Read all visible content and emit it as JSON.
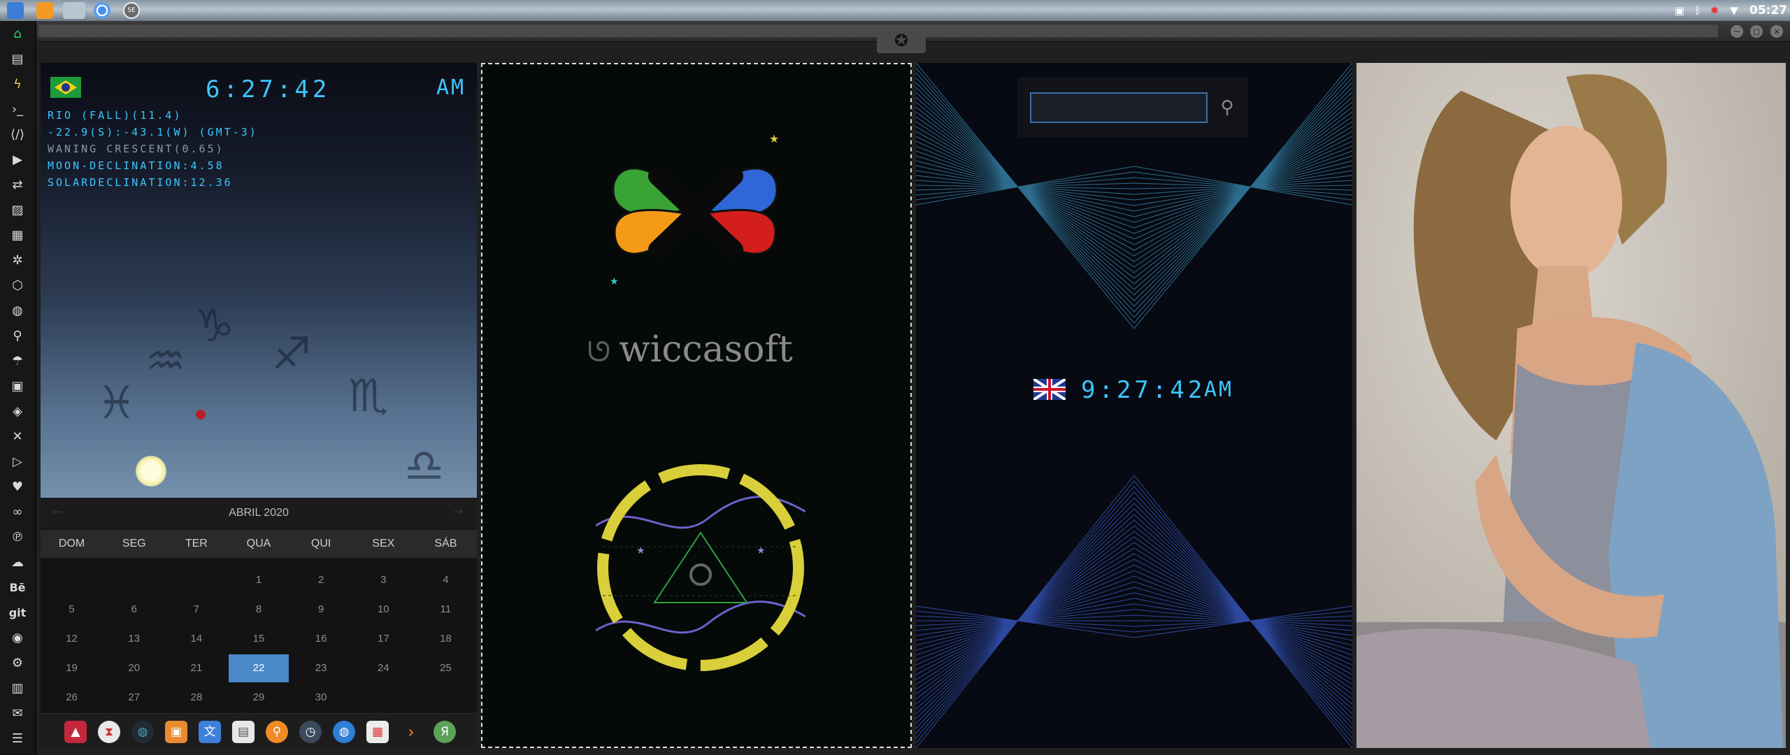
{
  "topbar": {
    "apps": [
      "files-icon",
      "sublime-icon",
      "blank-window",
      "chrome-icon",
      "se-icon"
    ],
    "se_label": "SE",
    "clock": "05:27"
  },
  "left_dock": {
    "items": [
      "home-icon",
      "document-icon",
      "flash-icon",
      "terminal-icon",
      "code-icon",
      "video-icon",
      "file-transfer-icon",
      "image-icon",
      "news-icon",
      "settings-icon",
      "hexagon-icon",
      "globe-icon",
      "search-icon",
      "umbrella-icon",
      "contacts-icon",
      "git-diff-icon",
      "shuffle-icon",
      "youtube-icon",
      "heart-icon",
      "link-icon",
      "pinterest-icon",
      "cloud-icon",
      "behance-icon",
      "git-icon",
      "github-icon",
      "bike-icon",
      "map-icon",
      "mail-icon",
      "terminal-window-icon"
    ],
    "behance_label": "Bē",
    "git_label": "git"
  },
  "window": {
    "rebel_glyph": "✪"
  },
  "brazil_clock": {
    "time": "6:27:42",
    "ampm": "AM",
    "location": "RIO (FALL)(11.4)",
    "coords": "-22.9(S):-43.1(W) (GMT-3)",
    "moon_phase": "WANING CRESCENT(0.65)",
    "moon_declination": "MOON-DECLINATION:4.58",
    "solar_declination": "SOLARDECLINATION:12.36"
  },
  "calendar": {
    "month": "ABRIL 2020",
    "weekdays": [
      "DOM",
      "SEG",
      "TER",
      "QUA",
      "QUI",
      "SEX",
      "SÁB"
    ],
    "days": [
      "1",
      "2",
      "3",
      "4",
      "5",
      "6",
      "7",
      "8",
      "9",
      "10",
      "11",
      "12",
      "13",
      "14",
      "15",
      "16",
      "17",
      "18",
      "19",
      "20",
      "21",
      "22",
      "23",
      "24",
      "25",
      "26",
      "27",
      "28",
      "29",
      "30"
    ],
    "first_weekday_index": 3,
    "today": "22",
    "prev_glyph": "←",
    "next_glyph": "→"
  },
  "app_dock": {
    "items": [
      "arch-icon",
      "hourglass-icon",
      "globe-dark-icon",
      "photos-icon",
      "translate-icon",
      "newspaper-icon",
      "magnifier-icon",
      "clock-icon",
      "web-icon",
      "calendar-icon",
      "arrow-icon",
      "yandex-icon"
    ],
    "yandex_label": "Я"
  },
  "wiccasoft": {
    "brand": "wiccasoft",
    "colors": {
      "green": "#3aa335",
      "blue": "#2f67d6",
      "orange": "#f59a17",
      "red": "#d41e1e",
      "ring": "#d8cf3a",
      "wave": "#6f5fc8",
      "triangle": "#2ca33a"
    }
  },
  "uk_clock": {
    "time": "9:27:42",
    "ampm": "AM"
  },
  "search": {
    "value": "",
    "placeholder": ""
  },
  "colors": {
    "digit": "#3ec6ff",
    "today_bg": "#4a88c7"
  }
}
